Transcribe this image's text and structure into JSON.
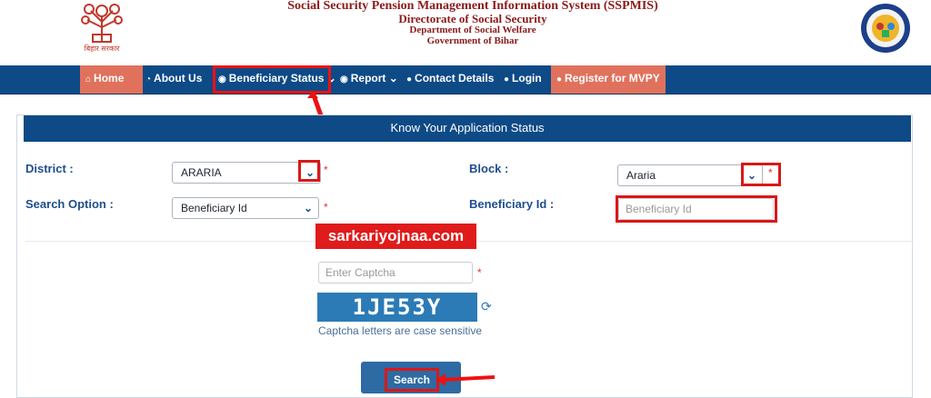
{
  "header": {
    "title_line1": "Social Security Pension Management Information System (SSPMIS)",
    "title_line2": "Directorate of Social Security",
    "title_line3": "Department of Social Welfare",
    "title_line4": "Government of Bihar",
    "left_logo_caption": "बिहार सरकार"
  },
  "nav": {
    "items": [
      {
        "label": "Home",
        "icon": "home-icon"
      },
      {
        "label": "About Us",
        "icon": "dashboard-icon"
      },
      {
        "label": "Beneficiary Status",
        "icon": "circle-arrow-icon",
        "dropdown": true
      },
      {
        "label": "Report",
        "icon": "circle-arrow-icon",
        "dropdown": true
      },
      {
        "label": "Contact Details",
        "icon": "user-icon"
      },
      {
        "label": "Login",
        "icon": "user-icon"
      },
      {
        "label": "Register for MVPY",
        "icon": "user-icon"
      }
    ]
  },
  "form": {
    "heading": "Know Your Application Status",
    "district_label": "District  :",
    "district_value": "ARARIA",
    "block_label": "Block  :",
    "block_value": "Araria",
    "search_option_label": "Search Option  :",
    "search_option_value": "Beneficiary Id",
    "beneficiary_id_label": "Beneficiary Id :",
    "beneficiary_id_placeholder": "Beneficiary Id",
    "captcha_placeholder": "Enter Captcha",
    "captcha_text": "1JE53Y",
    "captcha_note": "Captcha letters are case sensitive",
    "search_label": "Search",
    "required_mark": "*"
  },
  "watermark": "sarkariyojnaa.com",
  "colors": {
    "nav_bg": "#0e4a86",
    "nav_orange": "#e0725d",
    "highlight_red": "#d91818",
    "title_red": "#8b1a1a",
    "label_blue": "#1f4e8c"
  }
}
